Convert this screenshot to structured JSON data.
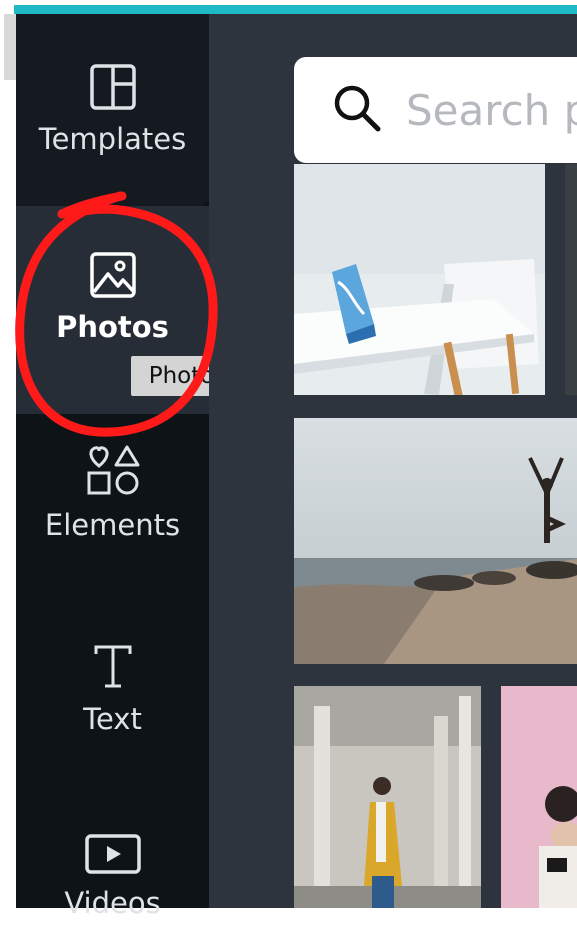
{
  "sidebar": {
    "items": [
      {
        "label": "Templates",
        "icon": "templates-icon"
      },
      {
        "label": "Photos",
        "icon": "photos-icon"
      },
      {
        "label": "Elements",
        "icon": "elements-icon"
      },
      {
        "label": "Text",
        "icon": "text-icon"
      },
      {
        "label": "Videos",
        "icon": "videos-icon"
      }
    ],
    "active": "Photos"
  },
  "tooltip": {
    "text": "Photos"
  },
  "search": {
    "placeholder": "Search photos",
    "icon": "search-icon"
  },
  "photos": [
    {
      "subject": "white table with blue object and chair"
    },
    {
      "subject": "person in yoga pose on rocky shore"
    },
    {
      "subject": "woman in yellow jacket"
    },
    {
      "subject": "person against pink wall"
    }
  ],
  "colors": {
    "accent": "#20b9c7",
    "sidebar_bg": "#0e1318",
    "active_bg": "#262d36",
    "panel_bg": "#2d343d",
    "annotation": "#ff1a1a"
  }
}
